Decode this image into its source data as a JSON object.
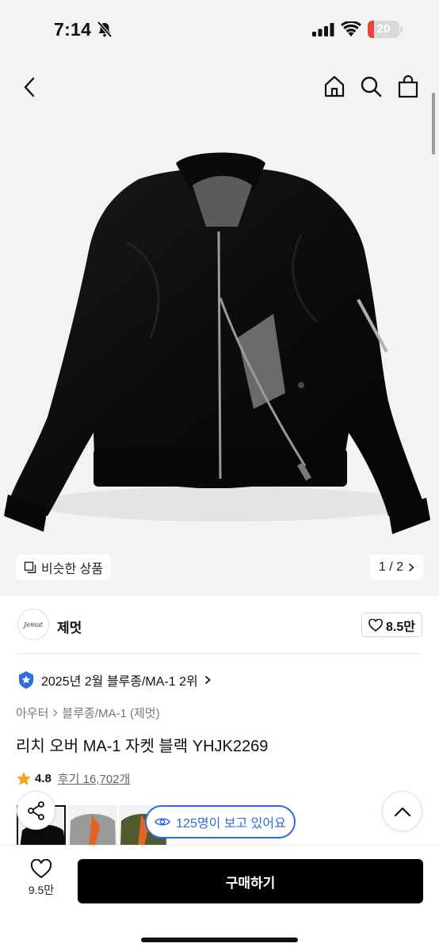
{
  "status_bar": {
    "time": "7:14",
    "battery": "20",
    "battery_level": 0.2,
    "battery_color": "#e8463f"
  },
  "header": {
    "back_icon": "chevron-left-icon",
    "home_icon": "home-icon",
    "search_icon": "search-icon",
    "cart_icon": "shopping-bag-icon"
  },
  "gallery": {
    "similar_label": "비슷한 상품",
    "page_indicator": "1 / 2"
  },
  "brand": {
    "logo_text": "Jemut",
    "name": "제멋",
    "like_count": "8.5만"
  },
  "ranking": {
    "text": "2025년 2월 블루종/MA-1 2위"
  },
  "breadcrumb": {
    "category": "아우터",
    "subcategory": "블루종/MA-1 (제멋)"
  },
  "product": {
    "title": "리치 오버 MA-1 자켓 블랙 YHJK2269",
    "rating": "4.8",
    "reviews": "후기 16,702개"
  },
  "viewers": {
    "text": "125명이 보고 있어요"
  },
  "bottom": {
    "wish_count": "9.5만",
    "buy_label": "구매하기"
  },
  "colors": {
    "accent": "#2d6ae3",
    "star": "#f5a623",
    "badge": "#2f6fde"
  }
}
